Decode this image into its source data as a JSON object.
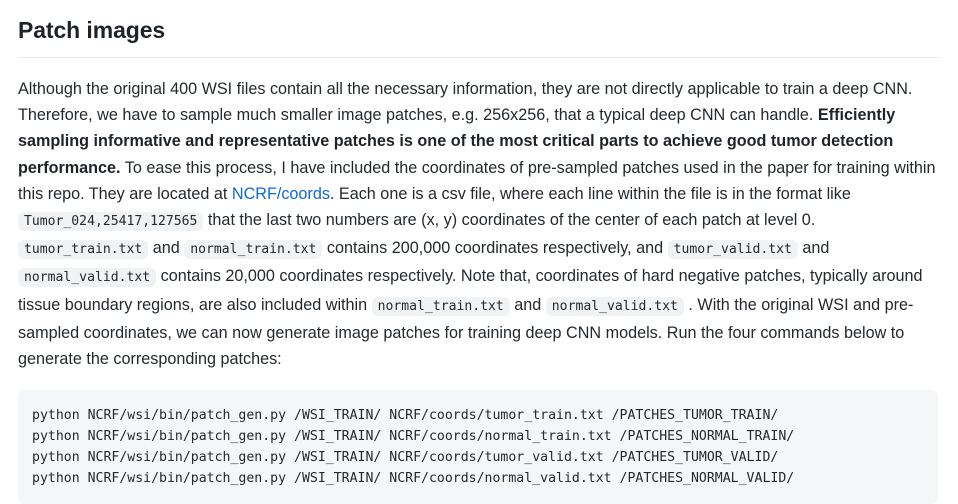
{
  "heading": {
    "title": "Patch images"
  },
  "paragraph": {
    "part1": "Although the original 400 WSI files contain all the necessary information, they are not directly applicable to train a deep CNN. Therefore, we have to sample much smaller image patches, e.g. 256x256, that a typical deep CNN can handle. ",
    "bold1": "Efficiently sampling informative and representative patches is one of the most critical parts to achieve good tumor detection performance.",
    "part2": " To ease this process, I have included the coordinates of pre-sampled patches used in the paper for training within this repo. They are located at ",
    "link_text": "NCRF/coords",
    "part3": ". Each one is a csv file, where each line within the file is in the format like ",
    "code1": "Tumor_024,25417,127565",
    "part4": " that the last two numbers are (x, y) coordinates of the center of each patch at level 0. ",
    "code2": "tumor_train.txt",
    "part5": " and ",
    "code3": "normal_train.txt",
    "part6": " contains 200,000 coordinates respectively, and ",
    "code4": "tumor_valid.txt",
    "part7": " and ",
    "code5": "normal_valid.txt",
    "part8": " contains 20,000 coordinates respectively. Note that, coordinates of hard negative patches, typically around tissue boundary regions, are also included within ",
    "code6": "normal_train.txt",
    "part9": " and ",
    "code7": "normal_valid.txt",
    "part10": " . With the original WSI and pre-sampled coordinates, we can now generate image patches for training deep CNN models. Run the four commands below to generate the corresponding patches:"
  },
  "code_block": {
    "lines": [
      "python NCRF/wsi/bin/patch_gen.py /WSI_TRAIN/ NCRF/coords/tumor_train.txt /PATCHES_TUMOR_TRAIN/",
      "python NCRF/wsi/bin/patch_gen.py /WSI_TRAIN/ NCRF/coords/normal_train.txt /PATCHES_NORMAL_TRAIN/",
      "python NCRF/wsi/bin/patch_gen.py /WSI_TRAIN/ NCRF/coords/tumor_valid.txt /PATCHES_TUMOR_VALID/",
      "python NCRF/wsi/bin/patch_gen.py /WSI_TRAIN/ NCRF/coords/normal_valid.txt /PATCHES_NORMAL_VALID/"
    ]
  },
  "colors": {
    "link": "#0b6ad8",
    "body_text": "#24292e",
    "heading_text": "#1f2328",
    "inline_code_bg": "#f1f2f4",
    "code_block_bg": "#f5f6f8",
    "rule": "#e8eaed"
  }
}
